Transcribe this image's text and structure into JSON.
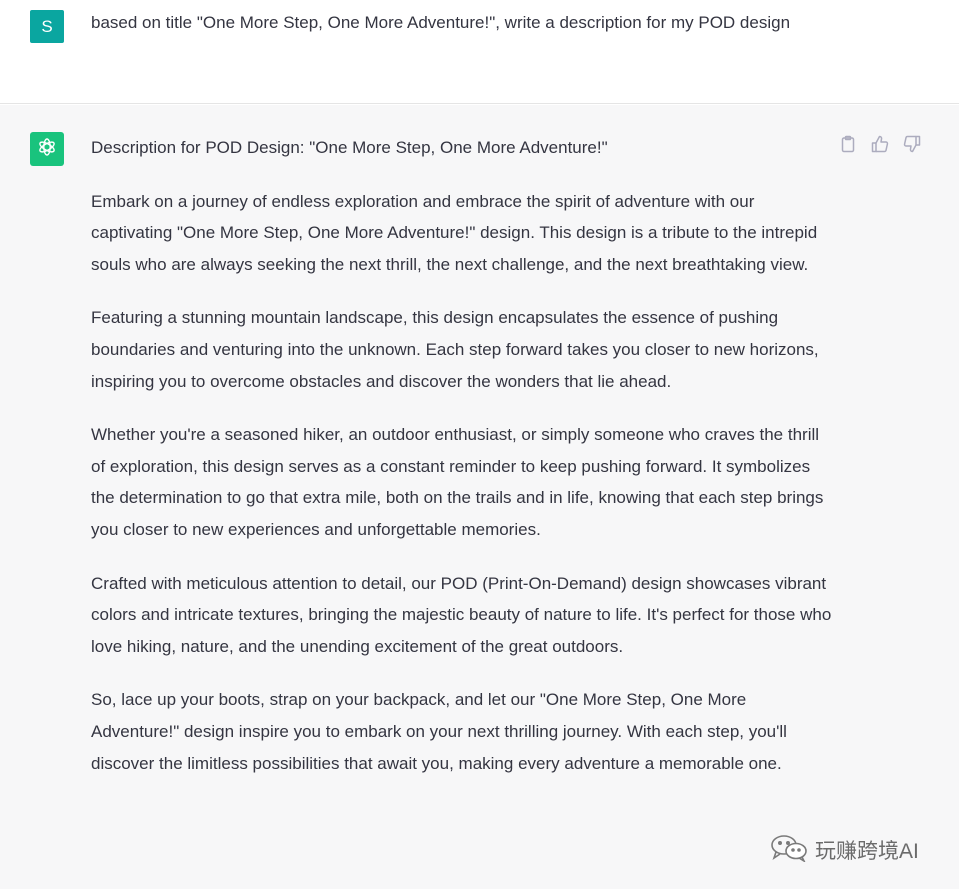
{
  "user": {
    "avatar_letter": "S",
    "prompt": "based on title \"One More Step, One More Adventure!\", write a description for my POD design"
  },
  "assistant": {
    "title": "Description for POD Design: \"One More Step, One More Adventure!\"",
    "paragraphs": [
      "Embark on a journey of endless exploration and embrace the spirit of adventure with our captivating \"One More Step, One More Adventure!\" design. This design is a tribute to the intrepid souls who are always seeking the next thrill, the next challenge, and the next breathtaking view.",
      "Featuring a stunning mountain landscape, this design encapsulates the essence of pushing boundaries and venturing into the unknown. Each step forward takes you closer to new horizons, inspiring you to overcome obstacles and discover the wonders that lie ahead.",
      "Whether you're a seasoned hiker, an outdoor enthusiast, or simply someone who craves the thrill of exploration, this design serves as a constant reminder to keep pushing forward. It symbolizes the determination to go that extra mile, both on the trails and in life, knowing that each step brings you closer to new experiences and unforgettable memories.",
      "Crafted with meticulous attention to detail, our POD (Print-On-Demand) design showcases vibrant colors and intricate textures, bringing the majestic beauty of nature to life. It's perfect for those who love hiking, nature, and the unending excitement of the great outdoors.",
      "So, lace up your boots, strap on your backpack, and let our \"One More Step, One More Adventure!\" design inspire you to embark on your next thrilling journey. With each step, you'll discover the limitless possibilities that await you, making every adventure a memorable one."
    ]
  },
  "icons": {
    "copy": "clipboard-icon",
    "like": "thumbs-up-icon",
    "dislike": "thumbs-down-icon",
    "logo": "openai-logo-icon",
    "watermark": "wechat-icon"
  },
  "watermark": {
    "text": "玩赚跨境AI"
  },
  "colors": {
    "user_avatar": "#0aa6a0",
    "assistant_avatar": "#19c37d",
    "assistant_bg": "#f7f7f8",
    "text": "#343541"
  }
}
